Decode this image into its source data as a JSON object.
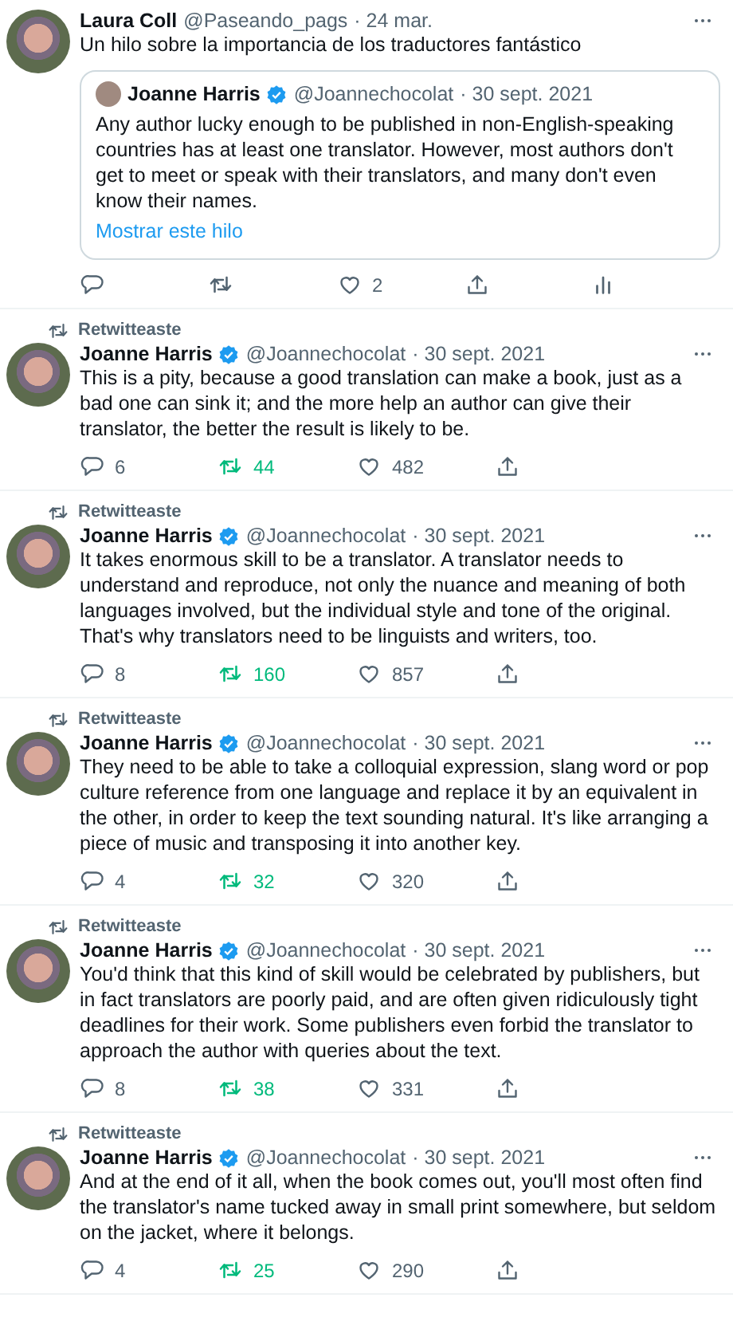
{
  "tweets": [
    {
      "author": "Laura Coll",
      "verified": false,
      "handle": "@Paseando_pags",
      "date": "· 24 mar.",
      "text": "Un hilo sobre la importancia de los traductores fantástico",
      "quote": {
        "author": "Joanne Harris",
        "verified": true,
        "handle": "@Joannechocolat",
        "date": "· 30 sept. 2021",
        "text": "Any author lucky enough to be published in non-English-speaking countries has at least one translator. However, most authors don't get to meet or speak with their translators, and many don't even know their names.",
        "link": "Mostrar este hilo"
      },
      "retweeted": false,
      "actions": [
        {
          "kind": "reply"
        },
        {
          "kind": "retweet"
        },
        {
          "kind": "like",
          "count": "2"
        },
        {
          "kind": "share"
        },
        {
          "kind": "analytics"
        }
      ]
    },
    {
      "social_context": "Retwitteaste",
      "author": "Joanne Harris",
      "verified": true,
      "handle": "@Joannechocolat",
      "date": "· 30 sept. 2021",
      "text": "This is a pity, because a good translation can make a book, just as a bad one can sink it; and the more help an author can give their translator, the better the result is likely to be.",
      "retweeted": true,
      "actions": [
        {
          "kind": "reply",
          "count": "6"
        },
        {
          "kind": "retweet",
          "count": "44"
        },
        {
          "kind": "like",
          "count": "482"
        },
        {
          "kind": "share"
        }
      ]
    },
    {
      "social_context": "Retwitteaste",
      "author": "Joanne Harris",
      "verified": true,
      "handle": "@Joannechocolat",
      "date": "· 30 sept. 2021",
      "text": "It takes enormous skill to be a translator. A translator needs to understand and reproduce, not only the nuance and meaning of both languages involved, but the individual style and tone of the original. That's why translators need to be linguists and writers, too.",
      "retweeted": true,
      "actions": [
        {
          "kind": "reply",
          "count": "8"
        },
        {
          "kind": "retweet",
          "count": "160"
        },
        {
          "kind": "like",
          "count": "857"
        },
        {
          "kind": "share"
        }
      ]
    },
    {
      "social_context": "Retwitteaste",
      "author": "Joanne Harris",
      "verified": true,
      "handle": "@Joannechocolat",
      "date": "· 30 sept. 2021",
      "text": "They need to be able to take a colloquial expression, slang word or pop culture reference from one language and replace it by an equivalent in the other, in order to keep the text sounding natural. It's like arranging a piece of music and transposing it into another key.",
      "retweeted": true,
      "actions": [
        {
          "kind": "reply",
          "count": "4"
        },
        {
          "kind": "retweet",
          "count": "32"
        },
        {
          "kind": "like",
          "count": "320"
        },
        {
          "kind": "share"
        }
      ]
    },
    {
      "social_context": "Retwitteaste",
      "author": "Joanne Harris",
      "verified": true,
      "handle": "@Joannechocolat",
      "date": "· 30 sept. 2021",
      "text": "You'd think that this kind of skill would be celebrated by publishers, but in fact translators are poorly paid, and are often given ridiculously tight deadlines for their work. Some publishers even forbid the translator to approach the author with queries about the text.",
      "retweeted": true,
      "actions": [
        {
          "kind": "reply",
          "count": "8"
        },
        {
          "kind": "retweet",
          "count": "38"
        },
        {
          "kind": "like",
          "count": "331"
        },
        {
          "kind": "share"
        }
      ]
    },
    {
      "social_context": "Retwitteaste",
      "author": "Joanne Harris",
      "verified": true,
      "handle": "@Joannechocolat",
      "date": "· 30 sept. 2021",
      "text": "And at the end of it all, when the book comes out, you'll most often find the translator's name tucked away in small print somewhere, but seldom on the jacket, where it belongs.",
      "retweeted": true,
      "actions": [
        {
          "kind": "reply",
          "count": "4"
        },
        {
          "kind": "retweet",
          "count": "25"
        },
        {
          "kind": "like",
          "count": "290"
        },
        {
          "kind": "share"
        }
      ]
    }
  ]
}
